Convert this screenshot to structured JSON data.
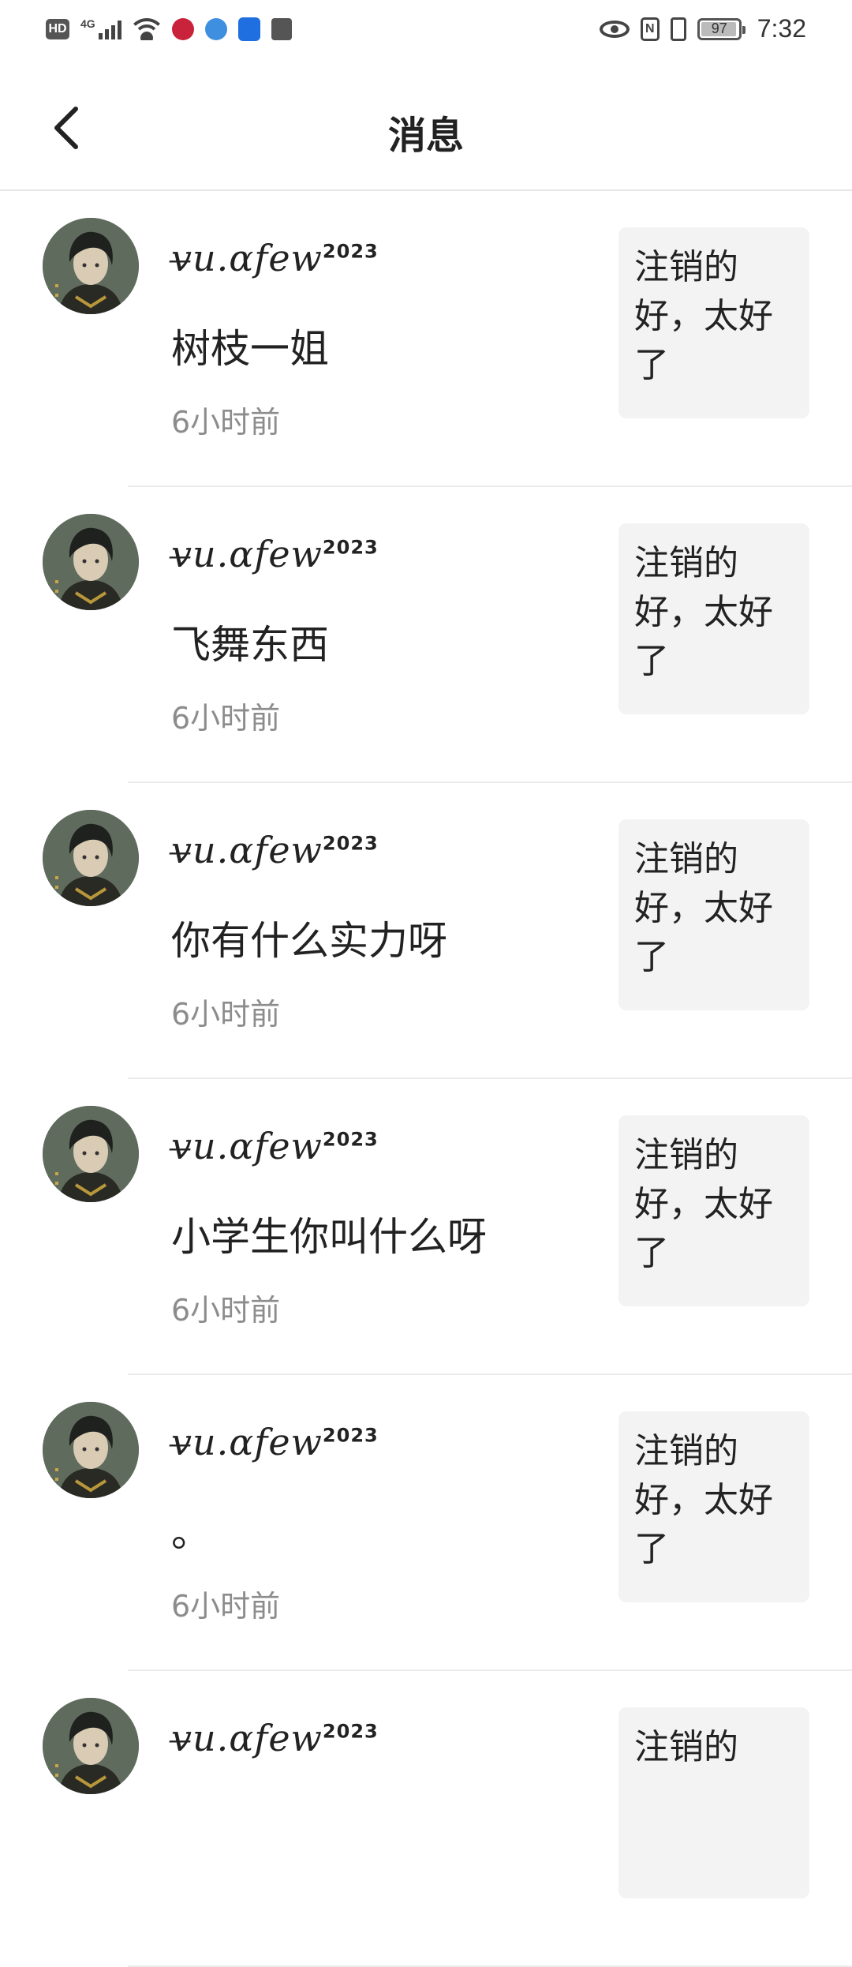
{
  "status_bar": {
    "hd": "HD",
    "network": "4G",
    "nfc": "N",
    "battery": "97",
    "battery_level": 0.97,
    "time": "7:32"
  },
  "header": {
    "title": "消息",
    "back_icon": "chevron-left-icon"
  },
  "messages": [
    {
      "username": "v̶u.ɑfew",
      "username_suffix": "2023",
      "text": "树枝一姐",
      "time": "6小时前",
      "quote": "注销的好，太好了"
    },
    {
      "username": "v̶u.ɑfew",
      "username_suffix": "2023",
      "text": "飞舞东西",
      "time": "6小时前",
      "quote": "注销的好，太好了"
    },
    {
      "username": "v̶u.ɑfew",
      "username_suffix": "2023",
      "text": "你有什么实力呀",
      "time": "6小时前",
      "quote": "注销的好，太好了"
    },
    {
      "username": "v̶u.ɑfew",
      "username_suffix": "2023",
      "text": "小学生你叫什么呀",
      "time": "6小时前",
      "quote": "注销的好，太好了"
    },
    {
      "username": "v̶u.ɑfew",
      "username_suffix": "2023",
      "text": "。",
      "time": "6小时前",
      "quote": "注销的好，太好了"
    },
    {
      "username": "v̶u.ɑfew",
      "username_suffix": "2023",
      "text": "",
      "time": "",
      "quote": "注销的"
    }
  ]
}
